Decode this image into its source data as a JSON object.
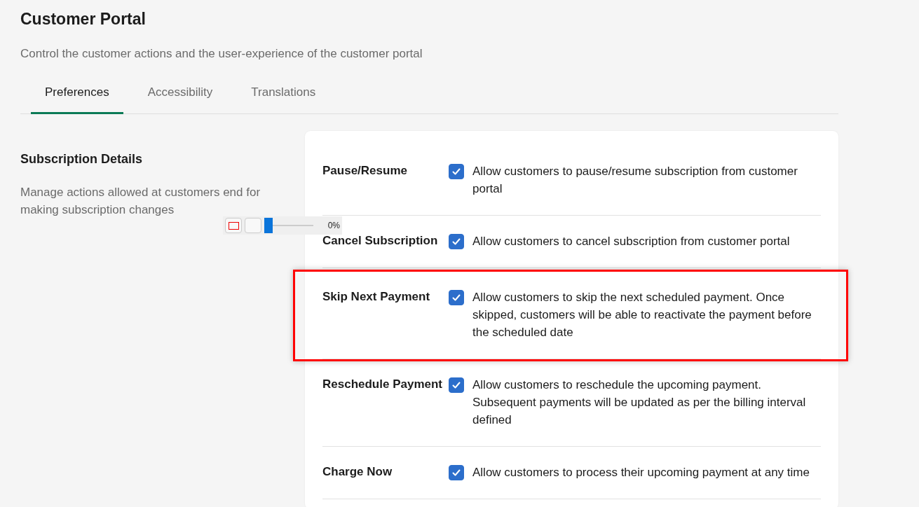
{
  "header": {
    "title": "Customer Portal",
    "subtitle": "Control the customer actions and the user-experience of the customer portal"
  },
  "tabs": [
    {
      "label": "Preferences",
      "selected": true
    },
    {
      "label": "Accessibility",
      "selected": false
    },
    {
      "label": "Translations",
      "selected": false
    }
  ],
  "section": {
    "title": "Subscription Details",
    "description": "Manage actions allowed at customers end for making subscription changes"
  },
  "settings": [
    {
      "label": "Pause/Resume",
      "checked": true,
      "highlighted": false,
      "description": "Allow customers to pause/resume subscription from customer portal"
    },
    {
      "label": "Cancel Subscription",
      "checked": true,
      "highlighted": false,
      "description": "Allow customers to cancel subscription from customer portal"
    },
    {
      "label": "Skip Next Payment",
      "checked": true,
      "highlighted": true,
      "description": "Allow customers to skip the next scheduled payment. Once skipped, customers will be able to reactivate the payment before the scheduled date"
    },
    {
      "label": "Reschedule Payment",
      "checked": true,
      "highlighted": false,
      "description": "Allow customers to reschedule the upcoming payment. Subsequent payments will be updated as per the billing interval defined"
    },
    {
      "label": "Charge Now",
      "checked": true,
      "highlighted": false,
      "description": "Allow customers to process their upcoming payment at any time"
    }
  ],
  "annotation_toolbar": {
    "level": 0,
    "reading": "0%"
  }
}
